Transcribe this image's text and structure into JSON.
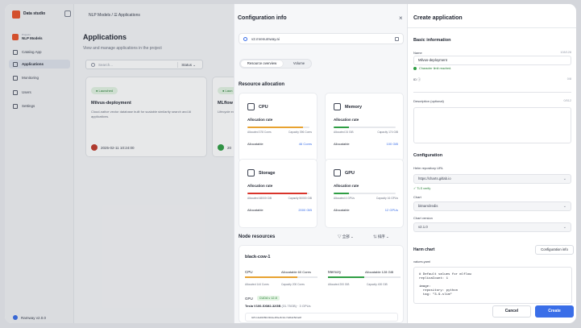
{
  "sidebar": {
    "brand": "Data studio",
    "project_label": "Projects",
    "project_name": "NLP Models",
    "items": [
      {
        "label": "Catalog App"
      },
      {
        "label": "Applications"
      },
      {
        "label": "Monitoring"
      },
      {
        "label": "Users"
      },
      {
        "label": "Settings"
      }
    ],
    "footer": "Ramway v2.0.0"
  },
  "main": {
    "breadcrumb": "NLP Models  /  ☰ Applications",
    "title": "Applications",
    "subtitle": "View and manage applications in the project",
    "search_placeholder": "Search...",
    "status_filter": "Status ⌄",
    "cards": [
      {
        "badge": "● Launched",
        "title": "Milvus-deployment",
        "desc": "Cloud-native vector database built for scalable similarity search and AI applications.",
        "date": "2025-02-11 10:24:00"
      },
      {
        "badge": "● Laun",
        "title": "MLflow",
        "desc": "Lifecycle experime",
        "date": "20"
      }
    ]
  },
  "config": {
    "title": "Configuration info",
    "close": "×",
    "url": "v2.mrenumway.ai",
    "tab_overview": "Resource overview",
    "tab_volume": "Volume",
    "resource_heading": "Resource allocation",
    "resources": [
      {
        "name": "CPU",
        "allocated": "Allocated  378 Cores",
        "capacity": "Capacity  396 Cores",
        "allocatable_value": "46 Cores",
        "fill": 0.9,
        "color": "#e8a230"
      },
      {
        "name": "Memory",
        "allocated": "Allocated  24 GiB",
        "capacity": "Capacity  174 GiB",
        "allocatable_value": "100 GiB",
        "fill": 0.25,
        "color": "#2f9e44"
      },
      {
        "name": "Storage",
        "allocated": "Allocated  48000 GiB",
        "capacity": "Capacity  50000 GiB",
        "allocatable_value": "2000 GiB",
        "fill": 0.96,
        "color": "#d9342b"
      },
      {
        "name": "GPU",
        "allocated": "Allocated  4 GPUs",
        "capacity": "Capacity  16 GPUs",
        "allocatable_value": "12 GPUs",
        "fill": 0.25,
        "color": "#2f9e44"
      }
    ],
    "rate_label": "Allocation rate",
    "allocatable_label": "Allocatable",
    "node_heading": "Node resources",
    "filter_1": "▽ 全部   ⌄",
    "filter_2": "⇅ 排序   ⌄",
    "node": {
      "name": "black-cow-1",
      "cpu_label": "CPU",
      "cpu_alloc": "Allocatable 60 Cores",
      "cpu_small_a": "Allocated  144 Cores",
      "cpu_small_b": "Capacity  200 Cores",
      "cpu_fill": 0.72,
      "mem_label": "Memory",
      "mem_alloc": "Allocatable 128 GiB",
      "mem_small_a": "Allocated  200 GiB",
      "mem_small_b": "Capacity  400 GiB",
      "mem_fill": 0.5,
      "gpu_label": "GPU",
      "gpu_badge": "CUDA v 12.8",
      "gpu_model": "Tesla V100-SXM2-32GB",
      "gpu_model_extra": "(31.75GB)  · 3 GPUs",
      "gpu_uuid": "GPU-2a913f92-6b2a-4f9e-8c1d-7a3b2c5d1e0f"
    }
  },
  "create": {
    "title": "Create application",
    "basic_heading": "Basic information",
    "name_label": "Name",
    "name_count": "108/128",
    "name_value": "Milvus-deployment",
    "name_ok": "Character limit reached.",
    "id_label": "ID ⓘ",
    "id_count": "0/8",
    "desc_label": "Description (optional)",
    "desc_count": "0/512",
    "config_heading": "Configuration",
    "helm_repo_label": "Helm repository URL",
    "helm_repo_value": "https://charts.gitlab.io",
    "helm_repo_ok": "✓ TLS verify",
    "chart_label": "Chart",
    "chart_value": "bitnami/redis",
    "chart_version_label": "Chart version",
    "chart_version_value": "v2.1.0",
    "helm_chart_label": "Harm chart",
    "config_info_button": "Configuration info",
    "values_label": "values.yaml",
    "values_yaml": "# Default values for mlflow\nreplicaCount: 1\n\nimage:\n  repository: python\n  tag: \"3.9-slim\"",
    "cancel": "Cancel",
    "create": "Create"
  }
}
